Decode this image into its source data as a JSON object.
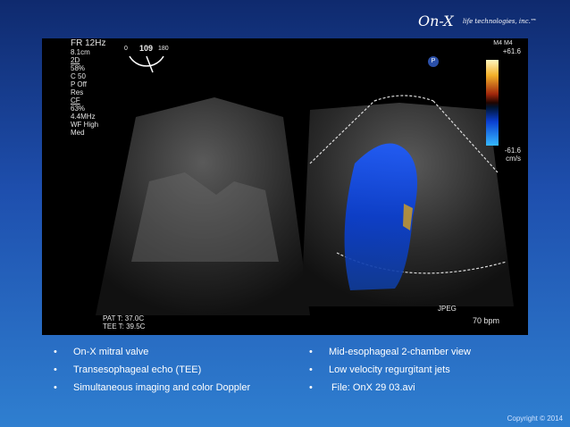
{
  "header": {
    "brand": "On-X",
    "tagline": "life technologies, inc.™"
  },
  "echo": {
    "settings": {
      "fr": "FR 12Hz",
      "depth": "8.1cm",
      "mode_2d": "2D",
      "gain": "58%",
      "comp": "C 50",
      "persist": "P Off",
      "res": "Res",
      "mode_cf": "CF",
      "cf_gain": "63%",
      "freq": "4.4MHz",
      "wf": "WF High",
      "med": "Med"
    },
    "angle": {
      "min": "0",
      "value": "109",
      "max": "180"
    },
    "probe_marker": "P",
    "scale_label": "M4 M4",
    "velocity_top": "+61.6",
    "velocity_bottom": "-61.6",
    "velocity_unit": "cm/s",
    "pat_temp": "PAT T: 37.0C",
    "tee_temp": "TEE T: 39.5C",
    "format": "JPEG",
    "heart_rate": "70 bpm"
  },
  "bullets": {
    "left": [
      "On-X mitral valve",
      "Transesophageal echo (TEE)",
      "Simultaneous imaging and color Doppler"
    ],
    "right": [
      "Mid-esophageal 2-chamber view",
      "Low velocity regurgitant jets",
      " File: OnX 29 03.avi"
    ],
    "bullet_char": "•"
  },
  "footer": {
    "copyright": "Copyright © 2014"
  }
}
